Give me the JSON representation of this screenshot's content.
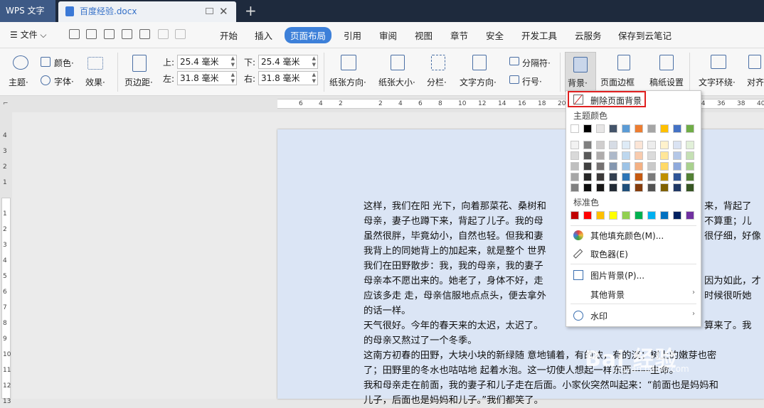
{
  "titlebar": {
    "app_tab": "WPS 文字",
    "doc_title": "百度经验.docx",
    "close": "✕",
    "new_tab": "+"
  },
  "menubar": {
    "file_menu": "☰ 文件 ⌵",
    "tabs": [
      "开始",
      "插入",
      "页面布局",
      "引用",
      "审阅",
      "视图",
      "章节",
      "安全",
      "开发工具",
      "云服务",
      "保存到云笔记"
    ],
    "active_tab": "页面布局"
  },
  "ribbon": {
    "theme": "主题·",
    "color": "颜色·",
    "font": "字体·",
    "effect": "效果·",
    "margin": "页边距·",
    "top_label": "上:",
    "top_value": "25.4 毫米",
    "bottom_label": "下:",
    "bottom_value": "25.4 毫米",
    "left_label": "左:",
    "left_value": "31.8 毫米",
    "right_label": "右:",
    "right_value": "31.8 毫米",
    "orientation": "纸张方向·",
    "size": "纸张大小·",
    "columns": "分栏·",
    "text_direction": "文字方向·",
    "separator": "分隔符·",
    "line_number": "行号·",
    "background": "背景·",
    "page_border": "页面边框",
    "grid_paper": "稿纸设置",
    "wrap_text": "文字环绕·",
    "align": "对齐"
  },
  "ruler": {
    "numbers": [
      "6",
      "4",
      "2",
      "",
      "2",
      "4",
      "6",
      "8",
      "10",
      "12",
      "14",
      "16",
      "18",
      "20",
      "22",
      "24",
      "26",
      "28",
      "30",
      "32",
      "34",
      "36",
      "38",
      "40"
    ],
    "v_numbers": [
      "4",
      "3",
      "2",
      "1",
      "",
      "1",
      "2",
      "3",
      "4",
      "5",
      "6",
      "7",
      "8",
      "9",
      "10",
      "11",
      "12",
      "13"
    ]
  },
  "document": {
    "lines": [
      "这样，我们在阳 光下，向着那菜花、桑树和",
      "母亲，妻子也蹲下来，背起了儿子。我的母",
      "虽然很胖，毕竟幼小，自然也轻。但我和妻",
      "我背上的同她背上的加起来，就是整个 世界",
      "我们在田野散步：我，我的母亲，我的妻子",
      "母亲本不愿出来的。她老了，身体不好，走",
      "应该多走 走，母亲信服地点点头，便去拿外",
      "的话一样。",
      "天气很好。今年的春天来的太迟，太迟了。",
      "的母亲又熬过了一个冬季。",
      "这南方初春的田野，大块小块的新绿随 意地铺着，有的浓，有的淡；树上的嫩芽也密",
      "了；田野里的冬水也咕咕地 起着水泡。这一切使人想起一样东西——生命。",
      "我和母亲走在前面，我的妻子和儿子走在后面。小家伙突然叫起来：“前面也是妈妈和",
      "儿子，后面也是妈妈和儿子。”我们都笑了。"
    ],
    "right_fragments": [
      "来，背起了",
      "不算重；儿",
      "很仔细，好像",
      "",
      "",
      "因为如此，才",
      "时候很听她",
      "",
      "算来了。我"
    ]
  },
  "dropdown": {
    "remove_bg": "删除页面背景",
    "theme_colors_label": "主题颜色",
    "standard_colors_label": "标准色",
    "theme_row": [
      "#ffffff",
      "#000000",
      "#e7e6e6",
      "#44546a",
      "#5b9bd5",
      "#ed7d31",
      "#a5a5a5",
      "#ffc000",
      "#4472c4",
      "#70ad47"
    ],
    "shade_rows": [
      [
        "#f2f2f2",
        "#7f7f7f",
        "#d0cece",
        "#d6dce5",
        "#deebf7",
        "#fbe5d6",
        "#ededed",
        "#fff2cc",
        "#dae3f3",
        "#e2f0d9"
      ],
      [
        "#d9d9d9",
        "#595959",
        "#aeabab",
        "#adb9ca",
        "#bdd7ee",
        "#f8cbad",
        "#dbdbdb",
        "#ffe699",
        "#b4c7e7",
        "#c5e0b4"
      ],
      [
        "#bfbfbf",
        "#404040",
        "#757171",
        "#8497b0",
        "#9dc3e6",
        "#f4b183",
        "#c9c9c9",
        "#ffd966",
        "#8faadc",
        "#a9d18e"
      ],
      [
        "#a6a6a6",
        "#262626",
        "#3b3838",
        "#333f50",
        "#2e75b6",
        "#c55a11",
        "#7b7b7b",
        "#bf9000",
        "#2f5597",
        "#538135"
      ],
      [
        "#808080",
        "#0d0d0d",
        "#171616",
        "#222a35",
        "#1f4e79",
        "#843c0c",
        "#525252",
        "#7f6000",
        "#203864",
        "#375623"
      ]
    ],
    "standard_row": [
      "#c00000",
      "#ff0000",
      "#ffc000",
      "#ffff00",
      "#92d050",
      "#00b050",
      "#00b0f0",
      "#0070c0",
      "#002060",
      "#7030a0"
    ],
    "more_fill": "其他填充颜色(M)...",
    "eyedropper": "取色器(E)",
    "picture_bg": "图片背景(P)...",
    "other_bg": "其他背景",
    "watermark": "水印",
    "arrow": "›"
  },
  "watermark": {
    "text": "Bai 经验",
    "sub": "jingyan.baidu.com"
  }
}
